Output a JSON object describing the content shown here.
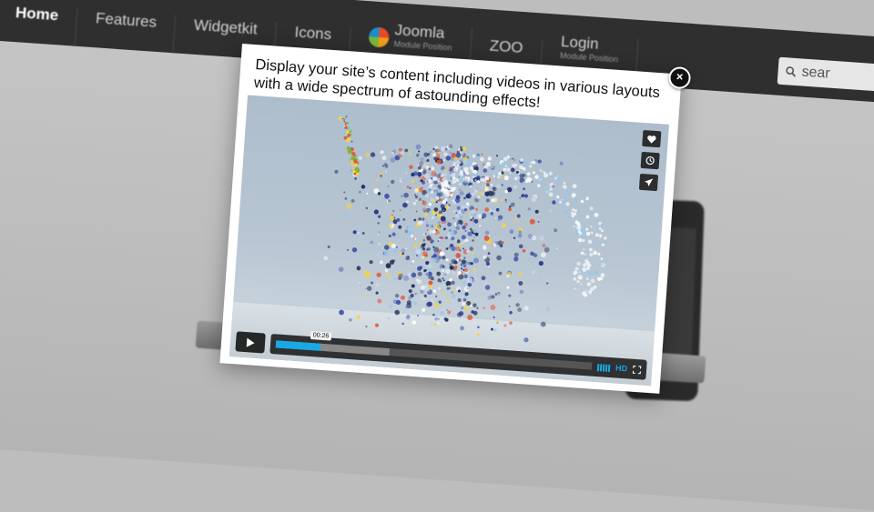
{
  "background": {
    "nav": [
      {
        "label": "Home"
      },
      {
        "label": "Features"
      },
      {
        "label": "Widgetkit"
      },
      {
        "label": "Icons"
      },
      {
        "label": "Joomla",
        "sub": "Module Position"
      },
      {
        "label": "ZOO"
      },
      {
        "label": "Login",
        "sub": "Module Position"
      }
    ],
    "search_text": "sear"
  },
  "modal": {
    "title": "Display your site’s content including videos in various layouts with a wide spectrum of astounding effects!",
    "close_glyph": "×"
  },
  "player": {
    "time_tooltip": "00:26",
    "progress_played": 0.14,
    "progress_loaded": 0.36,
    "hd_label": "HD",
    "side_icons": [
      "heart-icon",
      "clock-icon",
      "send-icon"
    ],
    "accent": "#19a8e6"
  }
}
